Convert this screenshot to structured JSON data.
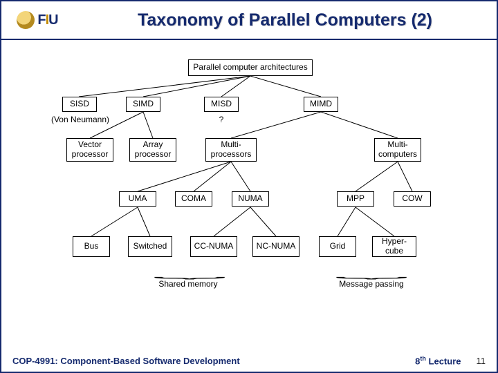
{
  "header": {
    "logo_text_parts": [
      "F",
      "I",
      "U"
    ],
    "title": "Taxonomy of Parallel Computers (2)"
  },
  "footer": {
    "course": "COP-4991: Component-Based Software Development",
    "lecture_ord": "8",
    "lecture_sup": "th",
    "lecture_word": "Lecture",
    "page": "11"
  },
  "diagram": {
    "root": "Parallel computer architectures",
    "l1": {
      "sisd": "SISD",
      "simd": "SIMD",
      "misd": "MISD",
      "mimd": "MIMD"
    },
    "l1_notes": {
      "sisd": "(Von Neumann)",
      "misd": "?"
    },
    "l2": {
      "vector": "Vector\nprocessor",
      "array": "Array\nprocessor",
      "mproc": "Multi-\nprocessors",
      "mcomp": "Multi-\ncomputers"
    },
    "l3": {
      "uma": "UMA",
      "coma": "COMA",
      "numa": "NUMA",
      "mpp": "MPP",
      "cow": "COW"
    },
    "l4": {
      "bus": "Bus",
      "switched": "Switched",
      "ccnuma": "CC-NUMA",
      "ncnuma": "NC-NUMA",
      "grid": "Grid",
      "hyper": "Hyper-\ncube"
    },
    "groups": {
      "shared": "Shared memory",
      "msg": "Message passing"
    }
  }
}
